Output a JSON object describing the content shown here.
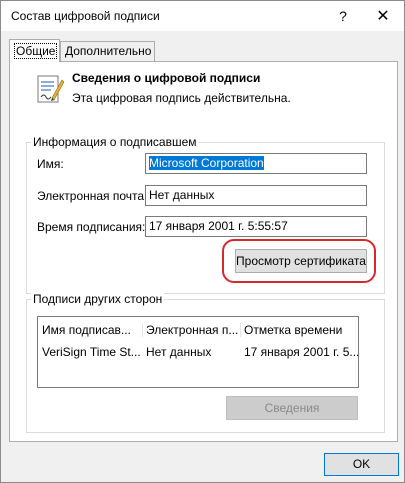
{
  "window": {
    "title": "Состав цифровой подписи",
    "help_glyph": "?",
    "close_glyph": "✕"
  },
  "tabs": [
    {
      "label": "Общие",
      "active": true
    },
    {
      "label": "Дополнительно",
      "active": false
    }
  ],
  "header": {
    "icon": "signed-document-icon",
    "title": "Сведения о цифровой подписи",
    "status": "Эта цифровая подпись действительна."
  },
  "signer": {
    "group_title": "Информация о подписавшем",
    "name_label": "Имя:",
    "name_value": "Microsoft Corporation",
    "email_label": "Электронная почта:",
    "email_value": "Нет данных",
    "time_label": "Время подписания:",
    "time_value": "17 января 2001 г. 5:55:57",
    "view_cert_button": "Просмотр сертификата"
  },
  "countersignatures": {
    "group_title": "Подписи других сторон",
    "columns": [
      "Имя подписав...",
      "Электронная п...",
      "Отметка времени"
    ],
    "rows": [
      [
        "VeriSign Time St...",
        "Нет данных",
        "17 января 2001 г. 5..."
      ]
    ],
    "details_button": "Сведения"
  },
  "footer": {
    "ok_button": "OK"
  },
  "colors": {
    "highlight": "#d9272e",
    "selection": "#0078d7"
  }
}
